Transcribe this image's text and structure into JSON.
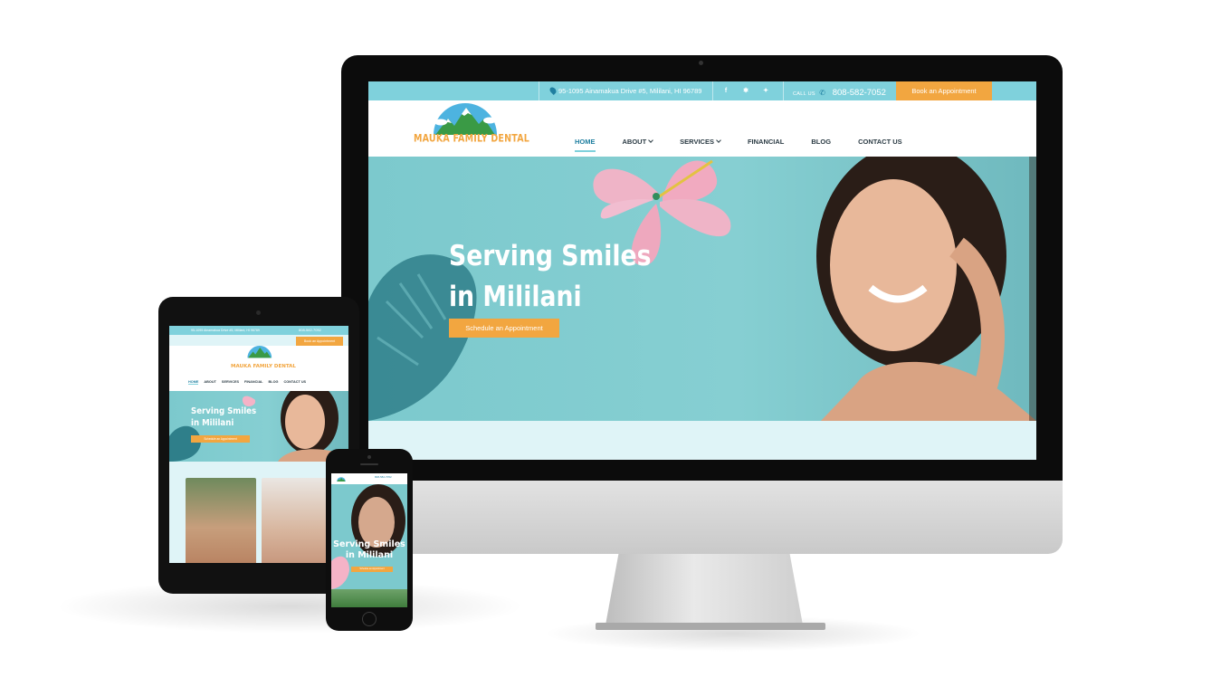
{
  "colors": {
    "teal": "#7fd1dc",
    "orange": "#f2a640",
    "dark_teal": "#1f7fa0",
    "nav_text": "#2b3b44",
    "hero_bg": "#86cfd2"
  },
  "desktop": {
    "topbar": {
      "address_icon": "map-pin-icon",
      "address": "95-1095 Ainamakua Drive #5, Mililani, HI 96789",
      "social_icons": [
        "facebook-icon",
        "yelp-icon",
        "twitter-icon"
      ],
      "call_label": "CALL US",
      "phone": "808-582-7052",
      "book_button": "Book an Appointment"
    },
    "logo_text": "MAUKA FAMILY DENTAL",
    "nav": {
      "home": "HOME",
      "about": "ABOUT",
      "services": "SERVICES",
      "financial": "FINANCIAL",
      "blog": "BLOG",
      "contact": "CONTACT US"
    },
    "hero": {
      "title_line1": "Serving Smiles",
      "title_line2": "in Mililani",
      "cta": "Schedule an Appointment"
    }
  },
  "tablet": {
    "address": "95-1095 Ainamakua Drive #5, Mililani, HI 96789",
    "phone": "808-582-7052",
    "book_button": "Book an Appointment",
    "logo_text": "MAUKA FAMILY DENTAL",
    "nav": [
      "HOME",
      "ABOUT",
      "SERVICES",
      "FINANCIAL",
      "BLOG",
      "CONTACT US"
    ],
    "hero_line1": "Serving Smiles",
    "hero_line2": "in Mililani",
    "cta": "Schedule an Appointment"
  },
  "phone": {
    "phone": "808-582-7052",
    "hero_line1": "Serving Smiles",
    "hero_line2": "in Mililani",
    "cta": "Schedule an Appointment"
  }
}
